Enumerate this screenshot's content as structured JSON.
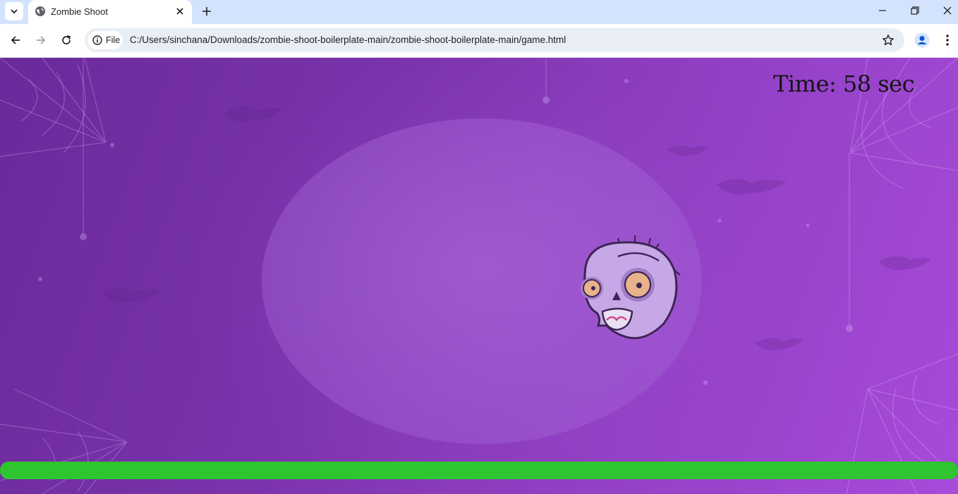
{
  "browser": {
    "tab_title": "Zombie Shoot",
    "file_chip_label": "File",
    "url": "C:/Users/sinchana/Downloads/zombie-shoot-boilerplate-main/zombie-shoot-boilerplate-main/game.html"
  },
  "game": {
    "timer_text": "Time: 58 sec",
    "health_fraction": 1.0,
    "colors": {
      "health_bar": "#2ec531",
      "background_start": "#6a2a9a",
      "background_end": "#a74ada"
    }
  },
  "icons": {
    "tab_search": "chevron-down-icon",
    "favicon": "globe-icon",
    "tab_close": "close-icon",
    "new_tab": "plus-icon",
    "minimize": "minimize-icon",
    "restore": "restore-icon",
    "close_window": "close-icon",
    "back": "arrow-left-icon",
    "forward": "arrow-right-icon",
    "reload": "reload-icon",
    "info": "info-icon",
    "bookmark": "star-icon",
    "profile": "person-icon",
    "menu": "kebab-menu-icon"
  }
}
